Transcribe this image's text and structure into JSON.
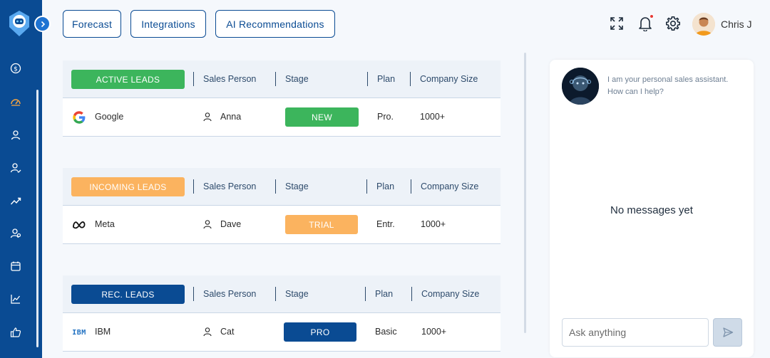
{
  "top_nav": {
    "buttons": [
      {
        "label": "Forecast"
      },
      {
        "label": "Integrations"
      },
      {
        "label": "AI Recommendations"
      }
    ],
    "user_name": "Chris J"
  },
  "sidebar": {
    "items": [
      {
        "icon": "dollar-icon"
      },
      {
        "icon": "dashboard-icon",
        "active": true
      },
      {
        "icon": "user-icon"
      },
      {
        "icon": "user-check-icon"
      },
      {
        "icon": "trend-icon"
      },
      {
        "icon": "users-icon"
      },
      {
        "icon": "calendar-icon"
      },
      {
        "icon": "chart-icon"
      },
      {
        "icon": "thumbs-up-icon"
      }
    ]
  },
  "columns": {
    "sales_person": "Sales Person",
    "stage": "Stage",
    "plan": "Plan",
    "company_size": "Company Size"
  },
  "groups": [
    {
      "title": "ACTIVE LEADS",
      "color": "#3cb55c",
      "row": {
        "company": "Google",
        "company_icon": "google-icon",
        "person": "Anna",
        "stage": "NEW",
        "stage_color": "#3cb55c",
        "plan": "Pro.",
        "size": "1000+"
      }
    },
    {
      "title": "INCOMING LEADS",
      "color": "#fbb35f",
      "row": {
        "company": "Meta",
        "company_icon": "meta-icon",
        "person": "Dave",
        "stage": "TRIAL",
        "stage_color": "#fbb35f",
        "plan": "Entr.",
        "size": "1000+"
      }
    },
    {
      "title": "REC. LEADS",
      "color": "#0a4b93",
      "row": {
        "company": "IBM",
        "company_icon": "ibm-icon",
        "logo_text": "IBM",
        "person": "Cat",
        "stage": "PRO",
        "stage_color": "#0a4b93",
        "plan": "Basic",
        "size": "1000+"
      }
    }
  ],
  "chat": {
    "greeting_line1": "I am your personal sales assistant.",
    "greeting_line2": "How can I help?",
    "empty_text": "No messages yet",
    "input_placeholder": "Ask anything"
  }
}
